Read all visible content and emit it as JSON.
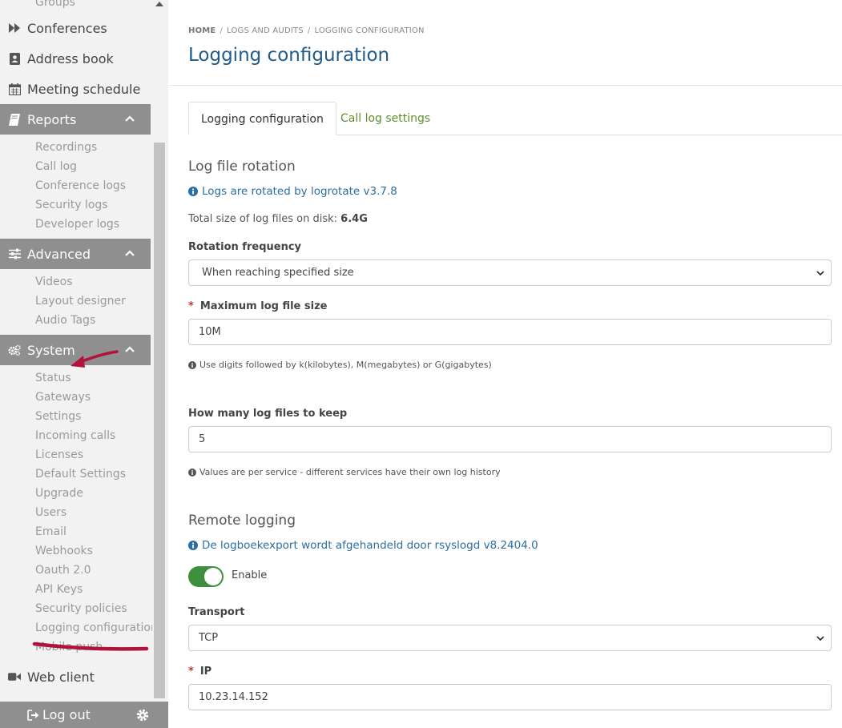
{
  "sidebar": {
    "top_items": [
      {
        "label": "Groups",
        "icon": "none"
      },
      {
        "label": "Conferences",
        "icon": "forward-icon"
      },
      {
        "label": "Address book",
        "icon": "address-book-icon"
      },
      {
        "label": "Meeting schedule",
        "icon": "calendar-icon"
      }
    ],
    "reports": {
      "label": "Reports",
      "icon": "book-icon",
      "items": [
        "Recordings",
        "Call log",
        "Conference logs",
        "Security logs",
        "Developer logs"
      ]
    },
    "advanced": {
      "label": "Advanced",
      "icon": "sliders-icon",
      "items": [
        "Videos",
        "Layout designer",
        "Audio Tags"
      ]
    },
    "system": {
      "label": "System",
      "icon": "gears-icon",
      "items": [
        "Status",
        "Gateways",
        "Settings",
        "Incoming calls",
        "Licenses",
        "Default Settings",
        "Upgrade",
        "Users",
        "Email",
        "Webhooks",
        "Oauth 2.0",
        "API Keys",
        "Security policies",
        "Logging configuration",
        "Mobile push"
      ]
    },
    "web_client": {
      "label": "Web client",
      "icon": "video-camera-icon"
    },
    "logout_label": "Log out",
    "colors": {
      "section_bg": "#8f8f8f",
      "annotation": "#b0143c"
    }
  },
  "breadcrumb": {
    "home": "HOME",
    "logs": "LOGS AND AUDITS",
    "current": "LOGGING CONFIGURATION"
  },
  "page": {
    "title": "Logging configuration",
    "tabs": {
      "active": "Logging configuration",
      "other": "Call log settings"
    }
  },
  "rotation": {
    "title": "Log file rotation",
    "info": "Logs are rotated by logrotate v3.7.8",
    "total_label": "Total size of log files on disk:",
    "total_value": "6.4G",
    "frequency_label": "Rotation frequency",
    "frequency_value": "When reaching specified size",
    "max_size_label": "Maximum log file size",
    "max_size_value": "10M",
    "max_size_help": "Use digits followed by k(kilobytes), M(megabytes) or G(gigabytes)",
    "keep_label": "How many log files to keep",
    "keep_value": "5",
    "keep_help": "Values are per service - different services have their own log history"
  },
  "remote": {
    "title": "Remote logging",
    "info": "De logboekexport wordt afgehandeld door rsyslogd v8.2404.0",
    "enable_label": "Enable",
    "transport_label": "Transport",
    "transport_value": "TCP",
    "ip_label": "IP",
    "ip_value": "10.23.14.152"
  }
}
